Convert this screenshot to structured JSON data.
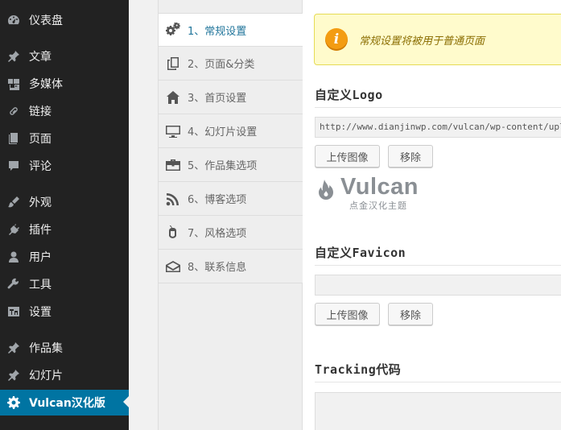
{
  "sidebar": {
    "items": [
      {
        "label": "仪表盘",
        "icon": "dashboard-icon"
      },
      {
        "label": "文章",
        "icon": "pin-icon"
      },
      {
        "label": "多媒体",
        "icon": "media-icon"
      },
      {
        "label": "链接",
        "icon": "link-icon"
      },
      {
        "label": "页面",
        "icon": "page-icon"
      },
      {
        "label": "评论",
        "icon": "comment-icon"
      },
      {
        "label": "外观",
        "icon": "appearance-icon"
      },
      {
        "label": "插件",
        "icon": "plugin-icon"
      },
      {
        "label": "用户",
        "icon": "user-icon"
      },
      {
        "label": "工具",
        "icon": "wrench-icon"
      },
      {
        "label": "设置",
        "icon": "settings-icon"
      },
      {
        "label": "作品集",
        "icon": "pin-icon"
      },
      {
        "label": "幻灯片",
        "icon": "pin-icon"
      },
      {
        "label": "Vulcan汉化版",
        "icon": "gear-icon",
        "active": true
      }
    ]
  },
  "tabs": [
    {
      "label": "1、常规设置",
      "icon": "gears-icon",
      "active": true
    },
    {
      "label": "2、页面&分类",
      "icon": "copy-icon"
    },
    {
      "label": "3、首页设置",
      "icon": "home-icon"
    },
    {
      "label": "4、幻灯片设置",
      "icon": "monitor-icon"
    },
    {
      "label": "5、作品集选项",
      "icon": "briefcase-icon"
    },
    {
      "label": "6、博客选项",
      "icon": "rss-icon"
    },
    {
      "label": "7、风格选项",
      "icon": "mouse-icon"
    },
    {
      "label": "8、联系信息",
      "icon": "envelope-icon"
    }
  ],
  "main": {
    "notice": "常规设置将被用于普通页面",
    "logo_section": {
      "title": "自定义Logo",
      "value": "http://www.dianjinwp.com/vulcan/wp-content/uploads/",
      "upload_label": "上传图像",
      "remove_label": "移除",
      "logo_word": "Vulcan",
      "logo_sub": "点金汉化主题"
    },
    "favicon_section": {
      "title": "自定义Favicon",
      "value": "",
      "upload_label": "上传图像",
      "remove_label": "移除"
    },
    "tracking_section": {
      "title": "Tracking代码"
    }
  },
  "colors": {
    "sidebar_bg": "#222222",
    "active_bg": "#0074a2",
    "active_tab_text": "#21759b",
    "notice_bg": "#fffbcc",
    "notice_icon": "#f39c12"
  }
}
